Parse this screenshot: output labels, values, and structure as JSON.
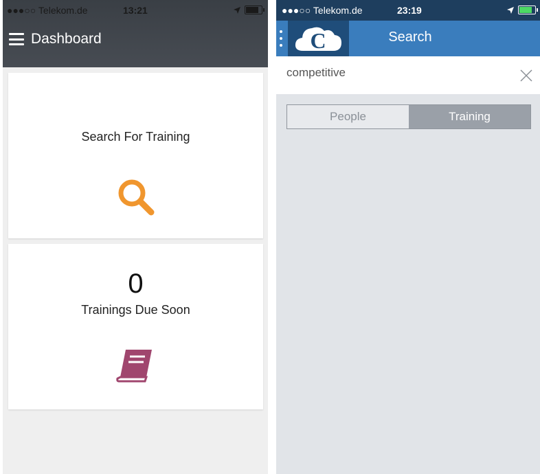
{
  "left_screen": {
    "status_bar": {
      "carrier": "●●●○○ Telekom.de",
      "time": "13:21"
    },
    "header": {
      "title": "Dashboard",
      "menu_icon": "hamburger-icon",
      "bg_color": "#3f444a"
    },
    "cards": {
      "search": {
        "label": "Search For Training",
        "icon": "search-icon",
        "icon_color": "#f0962e"
      },
      "due": {
        "count": "0",
        "label": "Trainings Due Soon",
        "icon": "book-icon",
        "icon_color": "#a0466e"
      }
    }
  },
  "right_screen": {
    "status_bar": {
      "carrier": "●●●○○ Telekom.de",
      "time": "23:19"
    },
    "header": {
      "title": "Search",
      "logo_letter": "C",
      "bg_color": "#3a7dbd"
    },
    "search": {
      "value": "competitive",
      "placeholder": ""
    },
    "segments": [
      {
        "label": "People",
        "active": false
      },
      {
        "label": "Training",
        "active": true
      }
    ]
  }
}
